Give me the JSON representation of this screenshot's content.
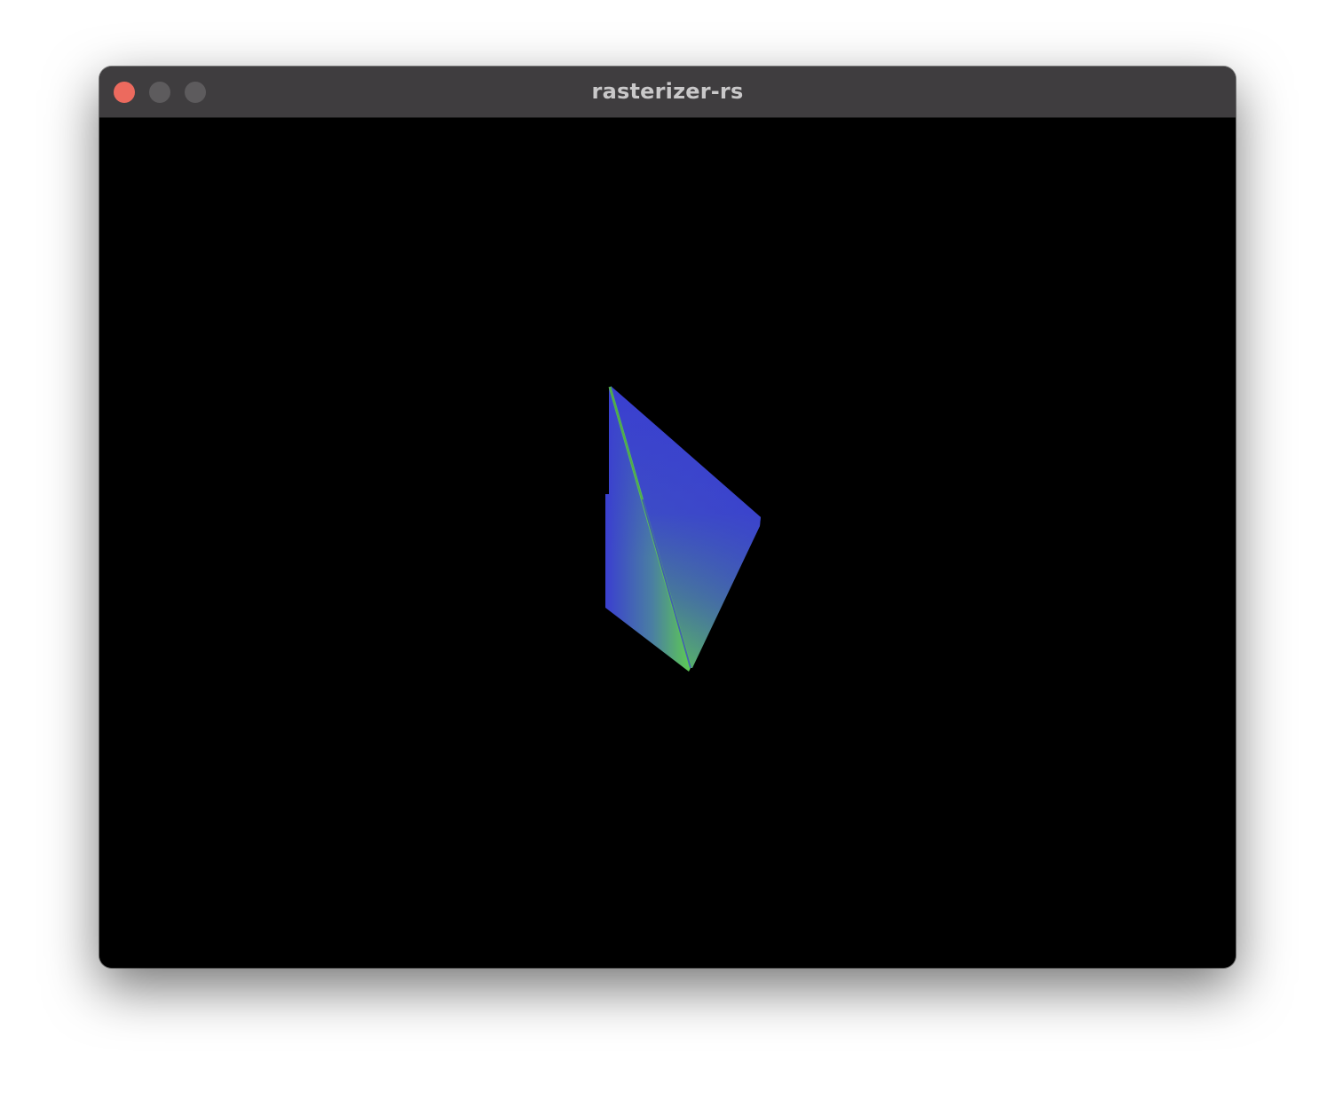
{
  "window": {
    "title": "rasterizer-rs",
    "controls": {
      "close_icon": "close-icon",
      "minimize_icon": "minimize-icon",
      "zoom_icon": "zoom-icon"
    },
    "colors": {
      "titlebar": "#3f3d3f",
      "close": "#ec6a5e",
      "inactive_control": "#5d5b5d",
      "title_text": "#c9c8c9"
    }
  },
  "scene": {
    "background": "#000000",
    "shape": "rotated-pyramid",
    "face_colors": [
      "#3a3fd0",
      "#5ecb52"
    ]
  }
}
